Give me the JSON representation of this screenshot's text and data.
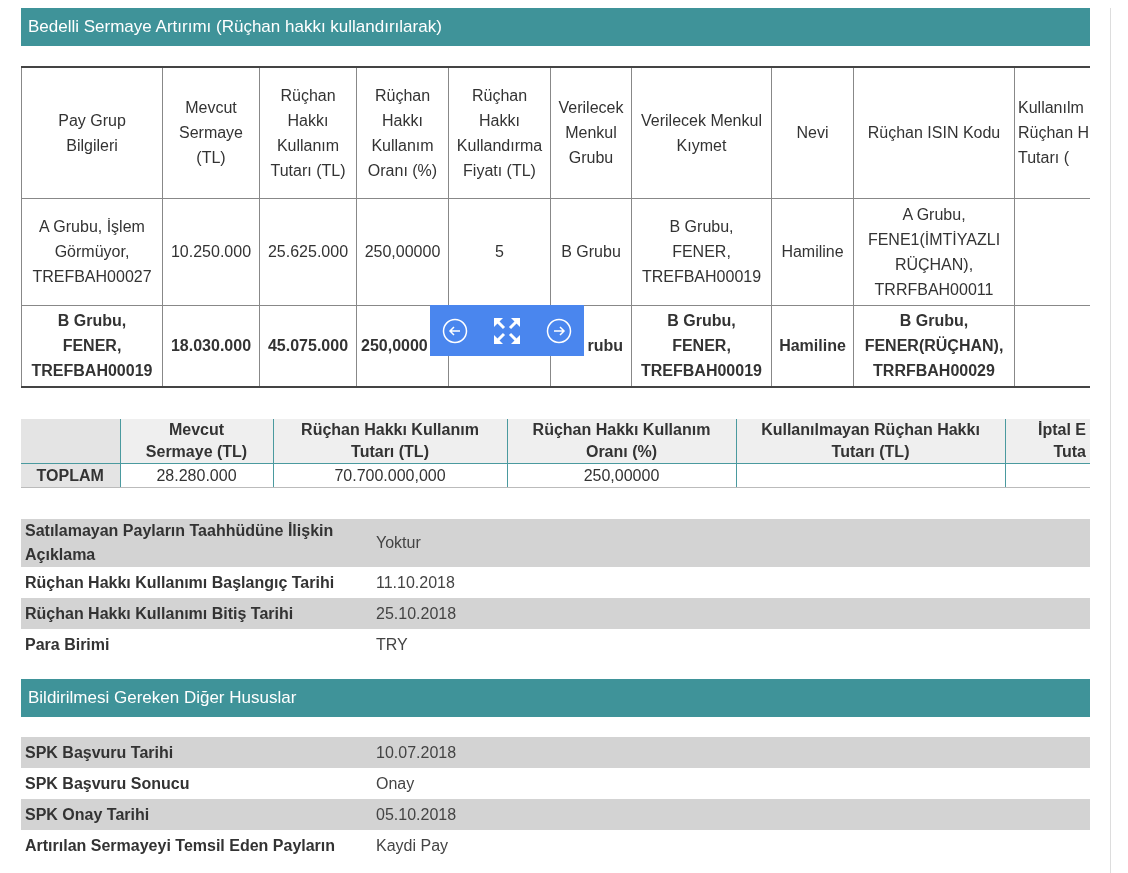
{
  "section_title": "Bedelli Sermaye Artırımı (Rüçhan hakkı kullandırılarak)",
  "groups_table": {
    "columns": [
      "Pay Grup\nBilgileri",
      "Mevcut\nSermaye\n(TL)",
      "Rüçhan\nHakkı\nKullanım\nTutarı (TL)",
      "Rüçhan\nHakkı\nKullanım\nOranı (%)",
      "Rüçhan\nHakkı\nKullandırma\nFiyatı (TL)",
      "Verilecek\nMenkul\nGrubu",
      "Verilecek Menkul\nKıymet",
      "Nevi",
      "Rüçhan ISIN Kodu",
      "Kullanılm\nRüçhan H\nTutarı ("
    ],
    "rows": [
      {
        "emphasized": false,
        "cells": [
          "A Grubu, İşlem\nGörmüyor,\nTREFBAH00027",
          "10.250.000",
          "25.625.000",
          "250,00000",
          "5",
          "B Grubu",
          "B Grubu,\nFENER,\nTREFBAH00019",
          "Hamiline",
          "A Grubu,\nFENE1(İMTİYAZLI\nRÜÇHAN),\nTRRFBAH00011"
        ]
      },
      {
        "emphasized": true,
        "cells": [
          "B Grubu,\nFENER,\nTREFBAH00019",
          "18.030.000",
          "45.075.000",
          "250,0000",
          null,
          "rubu",
          "B Grubu,\nFENER,\nTREFBAH00019",
          "Hamiline",
          "B Grubu,\nFENER(RÜÇHAN),\nTRRFBAH00029"
        ]
      }
    ]
  },
  "totals_table": {
    "columns": [
      "Mevcut\nSermaye (TL)",
      "Rüçhan Hakkı Kullanım\nTutarı (TL)",
      "Rüçhan Hakkı Kullanım\nOranı (%)",
      "Kullanılmayan Rüçhan Hakkı\nTutarı (TL)",
      "İptal E\nTuta"
    ],
    "row_label": "TOPLAM",
    "values": [
      "28.280.000",
      "70.700.000,000",
      "250,00000"
    ]
  },
  "details": [
    {
      "label": "Satılamayan Payların Taahhüdüne İlişkin Açıklama",
      "value": "Yoktur"
    },
    {
      "label": "Rüçhan Hakkı Kullanımı Başlangıç Tarihi",
      "value": "11.10.2018"
    },
    {
      "label": "Rüçhan Hakkı Kullanımı Bitiş Tarihi",
      "value": "25.10.2018"
    },
    {
      "label": "Para Birimi",
      "value": "TRY"
    }
  ],
  "other_title": "Bildirilmesi Gereken Diğer Hususlar",
  "other_details": [
    {
      "label": "SPK Başvuru Tarihi",
      "value": "10.07.2018"
    },
    {
      "label": "SPK Başvuru Sonucu",
      "value": "Onay"
    },
    {
      "label": "SPK Onay Tarihi",
      "value": "05.10.2018"
    },
    {
      "label": "Artırılan Sermayeyi Temsil Eden Payların",
      "value": "Kaydi Pay"
    }
  ]
}
